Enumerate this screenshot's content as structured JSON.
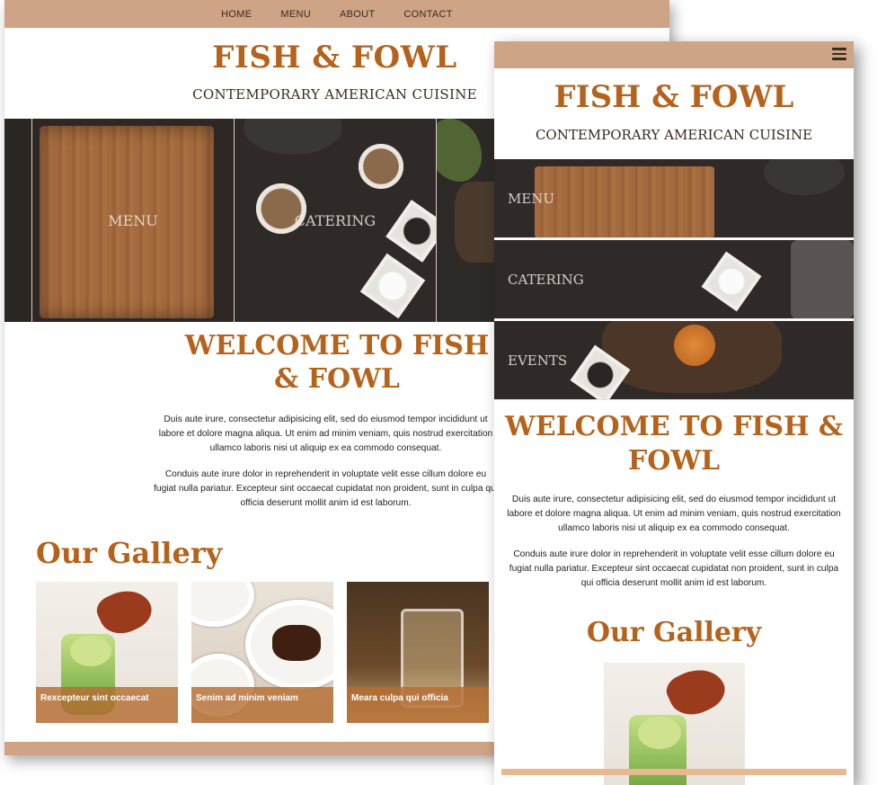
{
  "brand": {
    "name": "FISH & FOWL",
    "tagline": "CONTEMPORARY AMERICAN CUISINE",
    "accent_color": "#b5621b",
    "nav_color": "#cfa385"
  },
  "desktop": {
    "nav": {
      "items": [
        "HOME",
        "MENU",
        "ABOUT",
        "CONTACT"
      ]
    },
    "tiles": [
      {
        "label": "MENU"
      },
      {
        "label": "CATERING"
      }
    ],
    "welcome_heading": "WELCOME TO FISH & FOWL",
    "paragraphs": [
      "Duis aute irure, consectetur adipisicing elit, sed do eiusmod tempor incididunt ut labore et dolore magna aliqua. Ut enim ad minim veniam, quis nostrud exercitation ullamco laboris nisi ut aliquip ex ea commodo consequat.",
      "Conduis aute irure dolor in reprehenderit in voluptate velit esse cillum dolore eu fugiat nulla pariatur. Excepteur sint occaecat cupidatat non proident, sunt in culpa qui officia deserunt mollit anim id est laborum."
    ],
    "gallery_heading": "Our Gallery",
    "gallery": [
      {
        "caption": "Rexcepteur sint occaecat"
      },
      {
        "caption": "Senim ad minim veniam"
      },
      {
        "caption": "Meara culpa qui officia"
      }
    ]
  },
  "mobile": {
    "menu_icon": "hamburger-icon",
    "tiles": [
      {
        "label": "MENU"
      },
      {
        "label": "CATERING"
      },
      {
        "label": "EVENTS"
      }
    ],
    "welcome_heading": "WELCOME TO FISH & FOWL",
    "paragraphs": [
      "Duis aute irure, consectetur adipisicing elit, sed do eiusmod tempor incididunt ut labore et dolore magna aliqua. Ut enim ad minim veniam, quis nostrud exercitation ullamco laboris nisi ut aliquip ex ea commodo consequat.",
      "Conduis aute irure dolor in reprehenderit in voluptate velit esse cillum dolore eu fugiat nulla pariatur. Excepteur sint occaecat cupidatat non proident, sunt in culpa qui officia deserunt mollit anim id est laborum."
    ],
    "gallery_heading": "Our Gallery"
  }
}
